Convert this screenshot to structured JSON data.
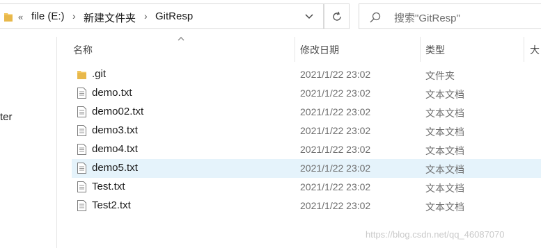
{
  "address_bar": {
    "overflow_glyph": "«",
    "crumbs": [
      "file (E:)",
      "新建文件夹",
      "GitResp"
    ],
    "separator": "›"
  },
  "search": {
    "placeholder": "搜索\"GitResp\""
  },
  "nav_pane": {
    "partial_item": "ter"
  },
  "columns": {
    "name": "名称",
    "date_modified": "修改日期",
    "type": "类型",
    "size": "大"
  },
  "files": [
    {
      "name": ".git",
      "date": "2021/1/22 23:02",
      "type": "文件夹",
      "icon": "folder-icon"
    },
    {
      "name": "demo.txt",
      "date": "2021/1/22 23:02",
      "type": "文本文档",
      "icon": "text-file-icon"
    },
    {
      "name": "demo02.txt",
      "date": "2021/1/22 23:02",
      "type": "文本文档",
      "icon": "text-file-icon"
    },
    {
      "name": "demo3.txt",
      "date": "2021/1/22 23:02",
      "type": "文本文档",
      "icon": "text-file-icon"
    },
    {
      "name": "demo4.txt",
      "date": "2021/1/22 23:02",
      "type": "文本文档",
      "icon": "text-file-icon"
    },
    {
      "name": "demo5.txt",
      "date": "2021/1/22 23:02",
      "type": "文本文档",
      "icon": "text-file-icon",
      "selected": true
    },
    {
      "name": "Test.txt",
      "date": "2021/1/22 23:02",
      "type": "文本文档",
      "icon": "text-file-icon"
    },
    {
      "name": "Test2.txt",
      "date": "2021/1/22 23:02",
      "type": "文本文档",
      "icon": "text-file-icon"
    }
  ],
  "watermark": "https://blog.csdn.net/qq_46087070",
  "colors": {
    "selection": "#e5f3fb",
    "folder": "#e8b84a",
    "border": "#d9d9d9"
  }
}
